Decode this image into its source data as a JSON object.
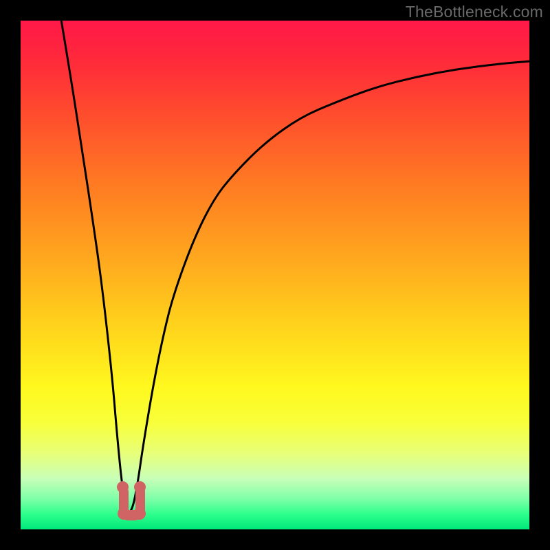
{
  "watermark": "TheBottleneck.com",
  "colors": {
    "frame": "#000000",
    "curve": "#000000",
    "foot_marker": "#d06464",
    "gradient_top": "#ff1848",
    "gradient_bottom": "#00e87a"
  },
  "chart_data": {
    "type": "line",
    "title": "",
    "xlabel": "",
    "ylabel": "",
    "xlim": [
      0,
      100
    ],
    "ylim": [
      0,
      100
    ],
    "grid": false,
    "legend": false,
    "annotations": [],
    "background": "vertical gradient: red (top, high) → orange → yellow → green (bottom, low)",
    "series": [
      {
        "name": "bottleneck-curve",
        "note": "V-shaped curve: steep drop from top-left to a minimum near x≈21, then asymptotic rise toward the right edge. Values estimated from pixel positions; y=100 is top, y=0 is bottom.",
        "x": [
          8,
          10,
          12,
          14,
          16,
          18,
          19,
          20,
          21,
          22,
          23,
          24,
          26,
          28,
          30,
          34,
          38,
          42,
          48,
          55,
          62,
          70,
          78,
          86,
          94,
          100
        ],
        "y": [
          100,
          88,
          75,
          62,
          48,
          30,
          18,
          8,
          3,
          4,
          9,
          16,
          28,
          38,
          46,
          57,
          65,
          70,
          76,
          81,
          84,
          87,
          89,
          90.5,
          91.5,
          92
        ]
      }
    ],
    "min_marker": {
      "note": "salmon U-shaped marker highlighting the curve minimum",
      "x_range": [
        19.5,
        23.5
      ],
      "y_range": [
        2,
        9
      ]
    }
  }
}
